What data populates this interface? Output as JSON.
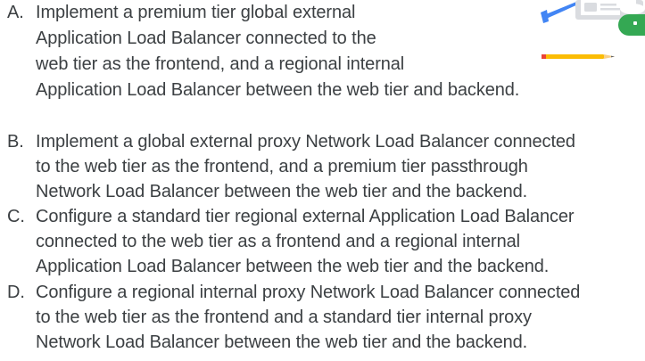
{
  "options": [
    {
      "letter": "A.",
      "lines": [
        "Implement a premium tier global external",
        "Application Load Balancer connected to the",
        "web tier as the frontend, and a regional internal",
        "Application Load Balancer between the web tier and backend."
      ]
    },
    {
      "letter": "B.",
      "lines": [
        "Implement a global external proxy Network Load Balancer connected",
        "to the web tier as the frontend, and a premium tier passthrough",
        "Network Load Balancer between the web tier and the backend."
      ]
    },
    {
      "letter": "C.",
      "lines": [
        "Configure a standard tier regional external Application Load Balancer",
        "connected to the web tier as a frontend and a regional internal",
        "Application Load Balancer between the web tier and the backend."
      ]
    },
    {
      "letter": "D.",
      "lines": [
        "Configure a regional internal proxy Network Load Balancer connected",
        "to the web tier as the frontend and a standard tier internal proxy",
        "Network Load Balancer between the web tier and the backend."
      ]
    }
  ],
  "illustration": {
    "colors": {
      "blue": "#4285f4",
      "green": "#34a853",
      "yellow": "#fbbc04",
      "red": "#ea4335",
      "grey": "#dadce0",
      "white": "#ffffff"
    }
  }
}
